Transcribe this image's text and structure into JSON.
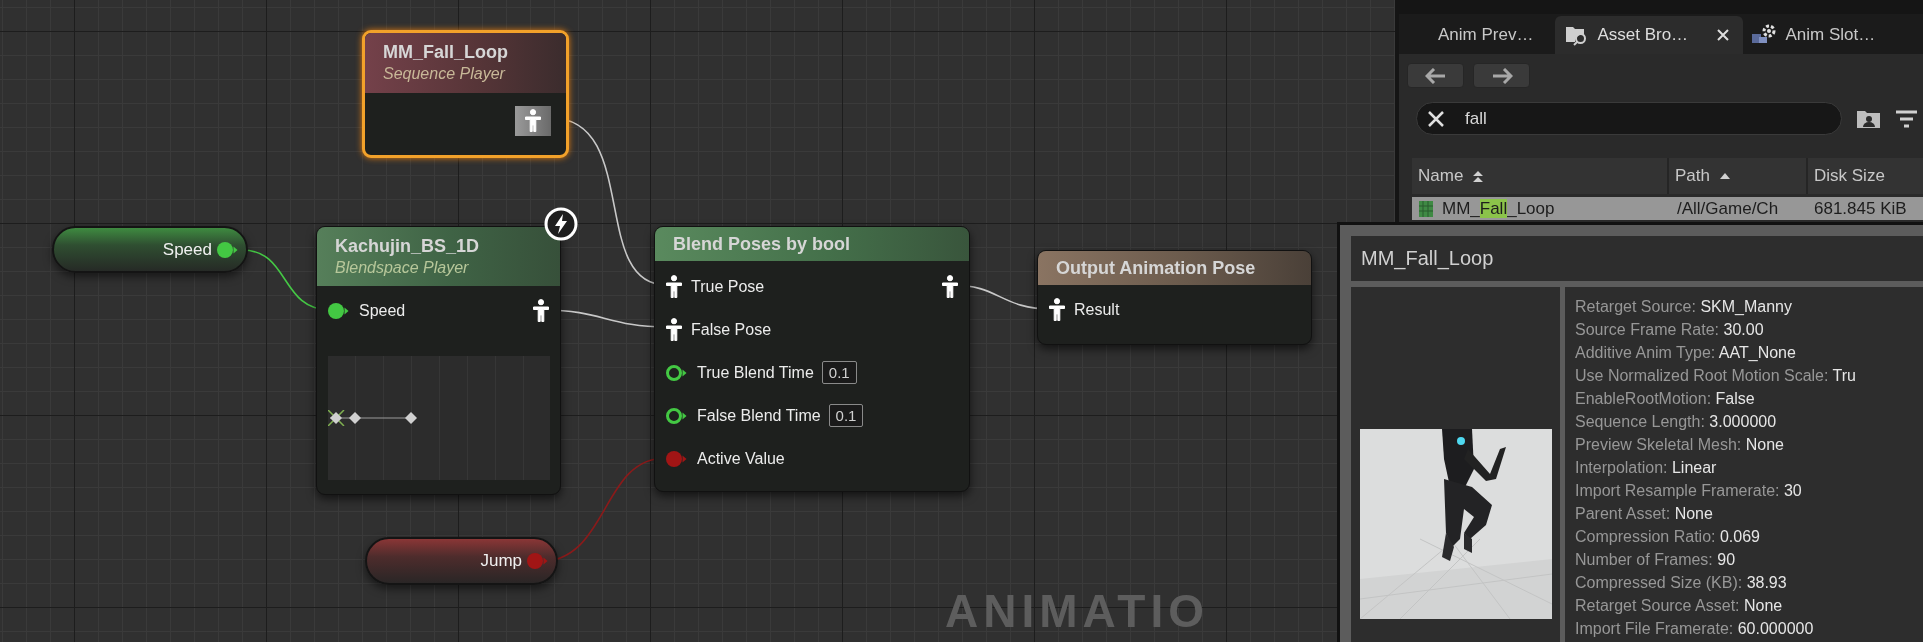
{
  "graph": {
    "watermark": "ANIMATIO",
    "nodes": [
      {
        "kind": "sequence_player",
        "title": "MM_Fall_Loop",
        "subtitle": "Sequence Player",
        "selected": true
      },
      {
        "kind": "float_variable",
        "label": "Speed",
        "selected": false
      },
      {
        "kind": "blendspace_player",
        "title": "Kachujin_BS_1D",
        "subtitle": "Blendspace Player",
        "selected": false,
        "inputs": [
          {
            "kind": "float",
            "label": "Speed",
            "connected": true
          }
        ]
      },
      {
        "kind": "bool_variable",
        "label": "Jump",
        "selected": false
      },
      {
        "kind": "blend",
        "title": "Blend Poses by bool",
        "selected": false,
        "inputs": [
          {
            "kind": "pose",
            "label": "True Pose",
            "connected": true
          },
          {
            "kind": "pose",
            "label": "False Pose",
            "connected": true
          },
          {
            "kind": "float",
            "label": "True Blend Time",
            "connected": false,
            "value": "0.1"
          },
          {
            "kind": "float",
            "label": "False Blend Time",
            "connected": false,
            "value": "0.1"
          },
          {
            "kind": "bool",
            "label": "Active Value",
            "connected": true
          }
        ]
      },
      {
        "kind": "output",
        "title": "Output Animation Pose",
        "selected": false,
        "inputs": [
          {
            "kind": "pose",
            "label": "Result",
            "connected": true
          }
        ]
      }
    ]
  },
  "asset_browser": {
    "tabs": [
      {
        "label": "Anim Prev…",
        "selected": false
      },
      {
        "label": "Asset Bro…",
        "selected": true
      },
      {
        "label": "Anim Slot…",
        "selected": false
      }
    ],
    "search": {
      "value": "fall"
    },
    "columns": [
      {
        "label": "Name",
        "kind": "dualsort"
      },
      {
        "label": "Path",
        "kind": "ascending"
      },
      {
        "label": "Disk Size",
        "kind": "plain"
      }
    ],
    "rows": [
      {
        "name_parts": [
          {
            "text": "MM_",
            "match": false
          },
          {
            "text": "Fall",
            "match": true
          },
          {
            "text": "_Loop",
            "match": false
          }
        ],
        "path": "/All/Game/Ch",
        "disk_size": "681.845 KiB",
        "selected": true
      }
    ]
  },
  "tooltip": {
    "title": "MM_Fall_Loop",
    "properties": [
      {
        "label": "Retarget Source:",
        "value": "SKM_Manny"
      },
      {
        "label": "Source Frame Rate:",
        "value": "30.00"
      },
      {
        "label": "Additive Anim Type:",
        "value": "AAT_None"
      },
      {
        "label": "Use Normalized Root Motion Scale:",
        "value": "Tru"
      },
      {
        "label": "EnableRootMotion:",
        "value": "False"
      },
      {
        "label": "Sequence Length:",
        "value": "3.000000"
      },
      {
        "label": "Preview Skeletal Mesh:",
        "value": "None"
      },
      {
        "label": "Interpolation:",
        "value": "Linear"
      },
      {
        "label": "Import Resample Framerate:",
        "value": "30"
      },
      {
        "label": "Parent Asset:",
        "value": "None"
      },
      {
        "label": "Compression Ratio:",
        "value": "0.069"
      },
      {
        "label": "Number of Frames:",
        "value": "90"
      },
      {
        "label": "Compressed Size (KB):",
        "value": "38.93"
      },
      {
        "label": "Retarget Source Asset:",
        "value": "None"
      },
      {
        "label": "Import File Framerate:",
        "value": "60.000000"
      }
    ]
  }
}
